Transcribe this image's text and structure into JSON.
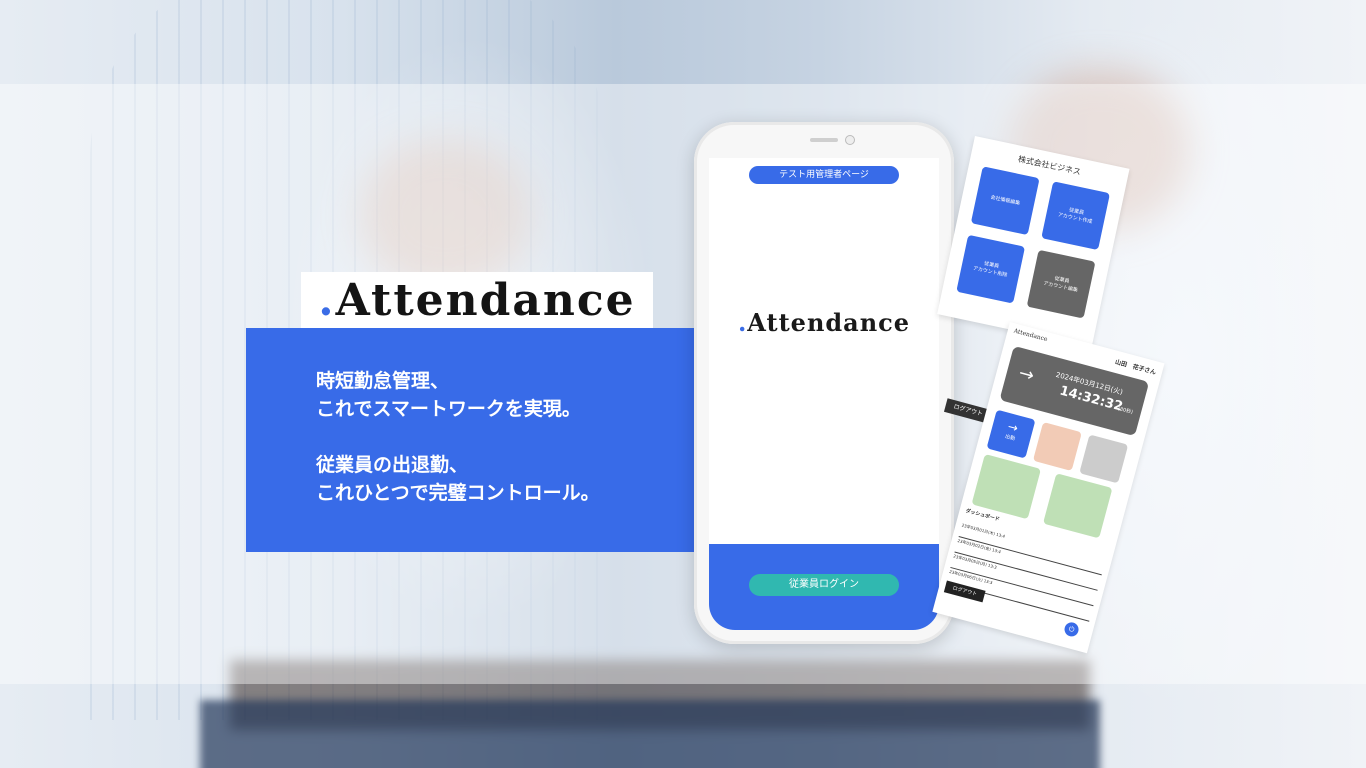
{
  "brand": {
    "logo_text": "Attendance",
    "accent_color": "#386be8"
  },
  "hero": {
    "lines": [
      "時短勤怠管理、",
      "これでスマートワークを実現。",
      "従業員の出退勤、",
      "これひとつで完璧コントロール。"
    ]
  },
  "phone": {
    "admin_button": "テスト用管理者ページ",
    "logo_text": "Attendance",
    "login_button": "従業員ログイン"
  },
  "admin_card": {
    "company": "株式会社ビジネス",
    "tiles": [
      {
        "label": "会社情報編集",
        "color": "#386be8"
      },
      {
        "label": "従業員\nアカウント作成",
        "color": "#386be8"
      },
      {
        "label": "従業員\nアカウント削除",
        "color": "#386be8"
      },
      {
        "label": "従業員\nアカウント編集",
        "color": "#666666"
      }
    ]
  },
  "employee_card": {
    "logo_text": "Attendance",
    "user_name": "山田　花子さん",
    "date": "2024年03月12日(火)",
    "time": "14:32:32",
    "seconds_note": "(30秒)",
    "clock_in": "出勤",
    "dashboard_title": "ダッシュボード",
    "rows": [
      "23年03月01日(木) 13:4",
      "23年03月02日(金) 13:4",
      "23年03月05日(月) 13:3",
      "23年03月06日(火) 13:3"
    ],
    "logout": "ログアウト"
  },
  "side_logout": "ログアウト"
}
